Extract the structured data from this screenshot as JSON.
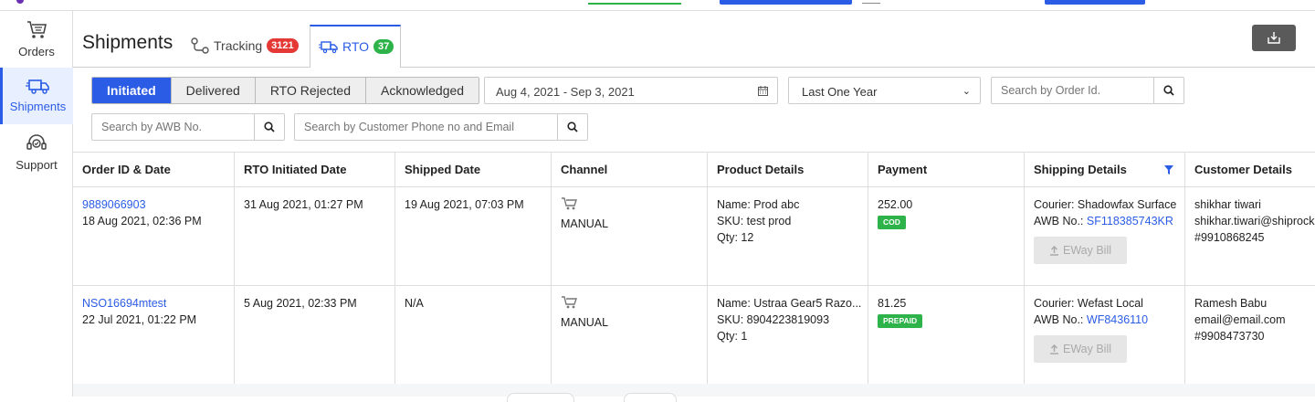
{
  "sidebar": {
    "items": [
      {
        "label": "Orders",
        "icon": "cart-icon"
      },
      {
        "label": "Shipments",
        "icon": "truck-icon"
      },
      {
        "label": "Support",
        "icon": "headset-icon"
      }
    ]
  },
  "header": {
    "title": "Shipments",
    "tabs": [
      {
        "label": "Tracking",
        "count": "3121",
        "icon": "route-icon"
      },
      {
        "label": "RTO",
        "count": "37",
        "icon": "return-truck-icon"
      }
    ]
  },
  "filters": {
    "status_tabs": [
      "Initiated",
      "Delivered",
      "RTO Rejected",
      "Acknowledged"
    ],
    "date_range": "Aug 4, 2021 - Sep 3, 2021",
    "period": "Last One Year",
    "order_search_placeholder": "Search by Order Id.",
    "awb_search_placeholder": "Search by AWB No.",
    "customer_search_placeholder": "Search by Customer Phone no and Email"
  },
  "table": {
    "columns": [
      "Order ID & Date",
      "RTO Initiated Date",
      "Shipped Date",
      "Channel",
      "Product Details",
      "Payment",
      "Shipping Details",
      "Customer Details"
    ],
    "rows": [
      {
        "order_id": "9889066903",
        "order_date": "18 Aug 2021, 02:36 PM",
        "rto_date": "31 Aug 2021, 01:27 PM",
        "shipped_date": "19 Aug 2021, 07:03 PM",
        "channel": "MANUAL",
        "product_name": "Name: Prod abc",
        "product_sku": "SKU: test prod",
        "product_qty": "Qty: 12",
        "amount": "252.00",
        "payment_mode": "COD",
        "courier": "Courier: Shadowfax Surface",
        "awb_label": "AWB No.:",
        "awb": "SF118385743KR",
        "eway": "EWay Bill",
        "customer_name": "shikhar tiwari",
        "customer_email": "shikhar.tiwari@shiprock",
        "customer_phone": "#9910868245"
      },
      {
        "order_id": "NSO16694mtest",
        "order_date": "22 Jul 2021, 01:22 PM",
        "rto_date": "5 Aug 2021, 02:33 PM",
        "shipped_date": "N/A",
        "channel": "MANUAL",
        "product_name": "Name: Ustraa Gear5 Razo...",
        "product_sku": "SKU: 8904223819093",
        "product_qty": "Qty: 1",
        "amount": "81.25",
        "payment_mode": "PREPAID",
        "courier": "Courier: Wefast Local",
        "awb_label": "AWB No.:",
        "awb": "WF8436110",
        "eway": "EWay Bill",
        "customer_name": "Ramesh Babu",
        "customer_email": "email@email.com",
        "customer_phone": "#9908473730"
      }
    ]
  },
  "colors": {
    "accent": "#2b5ce6",
    "success": "#2db34a",
    "danger": "#e53935"
  }
}
